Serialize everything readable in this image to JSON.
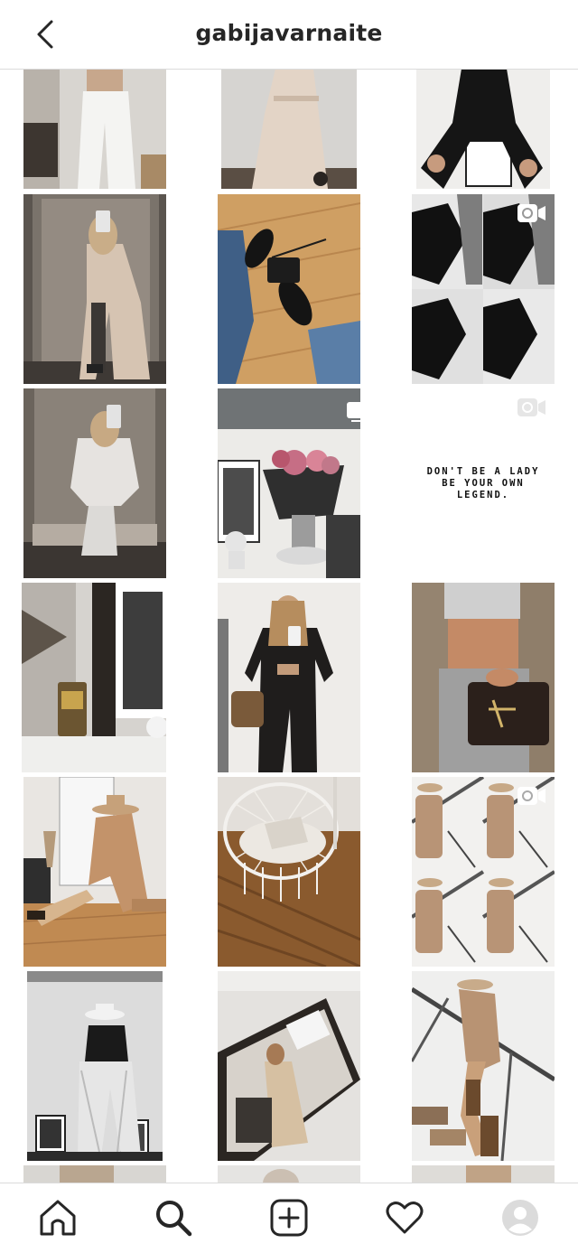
{
  "header": {
    "title": "gabijavarnaite",
    "back_icon": "chevron-left-icon"
  },
  "grid": {
    "posts": [
      {
        "kind": "photo",
        "subject": "white jeans"
      },
      {
        "kind": "photo",
        "subject": "beige trench coat"
      },
      {
        "kind": "photo",
        "subject": "black outfit crouching"
      },
      {
        "kind": "photo",
        "subject": "elevator mirror selfie in coat"
      },
      {
        "kind": "photo",
        "subject": "sneakers on wooden floor"
      },
      {
        "kind": "video",
        "subject": "black bow collage"
      },
      {
        "kind": "photo",
        "subject": "elevator mirror selfie puffer"
      },
      {
        "kind": "carousel",
        "subject": "flowers in vase"
      },
      {
        "kind": "video",
        "subject": "quote",
        "text_lines": [
          "DON'T BE A LADY",
          "BE YOUR OWN",
          "LEGEND."
        ]
      },
      {
        "kind": "photo",
        "subject": "candle still life"
      },
      {
        "kind": "photo",
        "subject": "black blazer mirror selfie"
      },
      {
        "kind": "photo",
        "subject": "handbag and sweater"
      },
      {
        "kind": "photo",
        "subject": "hat and camel coat on floor"
      },
      {
        "kind": "photo",
        "subject": "hanging chair with laptop"
      },
      {
        "kind": "video",
        "subject": "stairs collage"
      },
      {
        "kind": "photo",
        "subject": "black and white with hat"
      },
      {
        "kind": "photo",
        "subject": "mirror reflection"
      },
      {
        "kind": "photo",
        "subject": "stair railing with boots"
      }
    ]
  },
  "tabbar": {
    "items": [
      {
        "name": "home",
        "icon": "home-icon"
      },
      {
        "name": "search",
        "icon": "search-icon",
        "active": true
      },
      {
        "name": "new-post",
        "icon": "add-post-icon"
      },
      {
        "name": "activity",
        "icon": "heart-icon"
      },
      {
        "name": "profile",
        "icon": "avatar-icon"
      }
    ]
  },
  "colors": {
    "text": "#262626",
    "divider": "#dbdbdb",
    "background": "#ffffff"
  }
}
